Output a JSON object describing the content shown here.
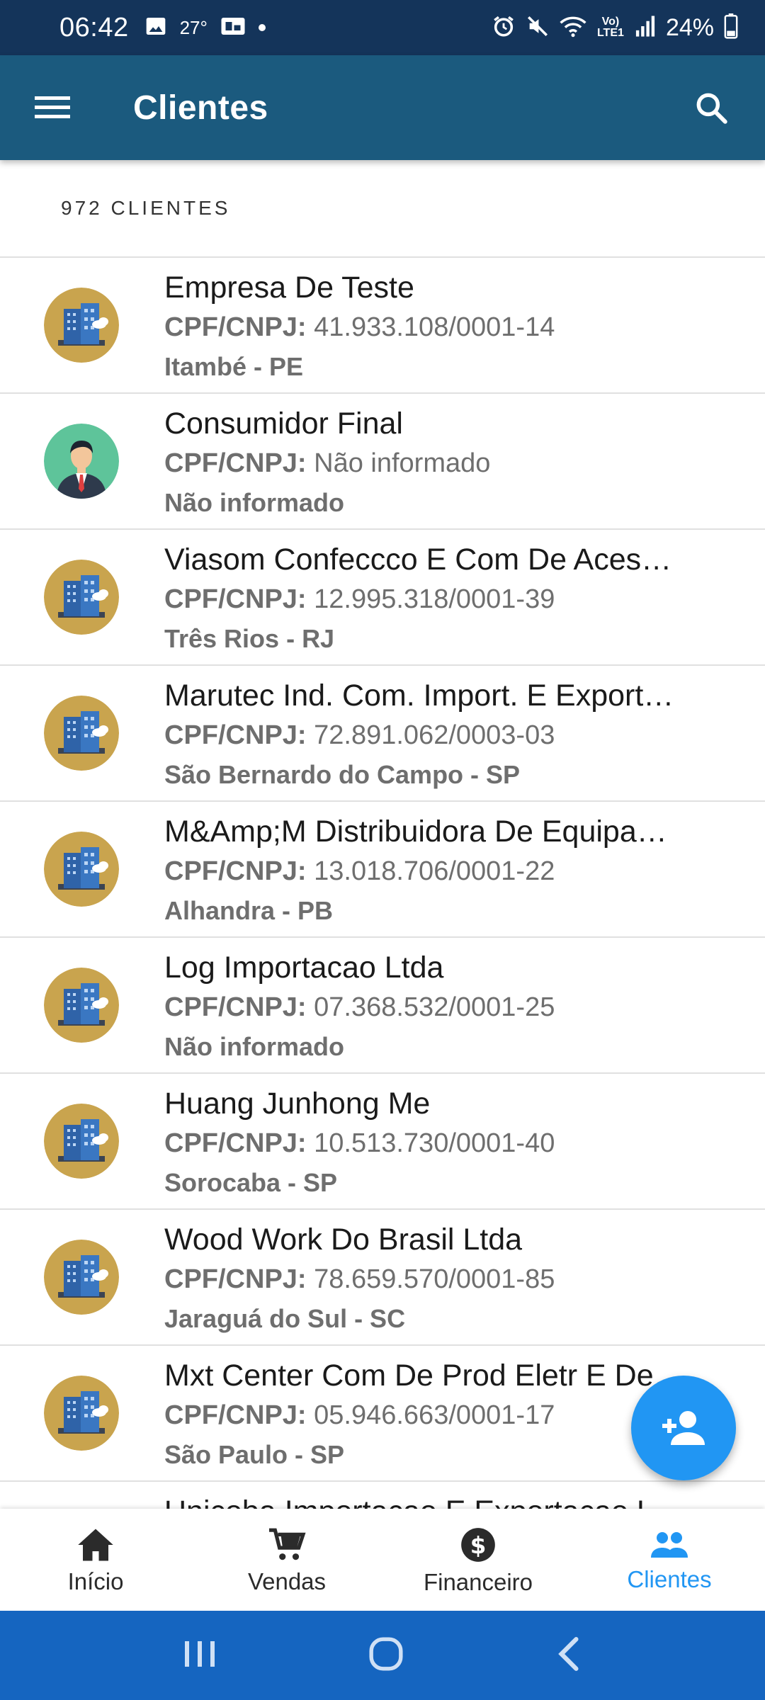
{
  "status_bar": {
    "time": "06:42",
    "temperature": "27°",
    "battery": "24%",
    "network_label": "Vo) LTE1"
  },
  "app_bar": {
    "title": "Clientes"
  },
  "list_header": {
    "count_label": "972 CLIENTES"
  },
  "doc_label": "CPF/CNPJ:",
  "clients": [
    {
      "name": "Empresa De Teste",
      "doc": "41.933.108/0001-14",
      "city": "Itambé - PE",
      "avatar": "building-avatar"
    },
    {
      "name": "Consumidor Final",
      "doc": "Não informado",
      "city": "Não informado",
      "avatar": "person-avatar"
    },
    {
      "name": "Viasom Confeccco E Com De Aces…",
      "doc": "12.995.318/0001-39",
      "city": "Três Rios - RJ",
      "avatar": "building-avatar"
    },
    {
      "name": "Marutec Ind. Com. Import. E Export…",
      "doc": "72.891.062/0003-03",
      "city": "São Bernardo do Campo - SP",
      "avatar": "building-avatar"
    },
    {
      "name": "M&Amp;M Distribuidora De Equipa…",
      "doc": "13.018.706/0001-22",
      "city": "Alhandra - PB",
      "avatar": "building-avatar"
    },
    {
      "name": "Log Importacao Ltda",
      "doc": "07.368.532/0001-25",
      "city": "Não informado",
      "avatar": "building-avatar"
    },
    {
      "name": "Huang Junhong Me",
      "doc": "10.513.730/0001-40",
      "city": "Sorocaba - SP",
      "avatar": "building-avatar"
    },
    {
      "name": "Wood Work Do Brasil Ltda",
      "doc": "78.659.570/0001-85",
      "city": "Jaraguá do Sul - SC",
      "avatar": "building-avatar"
    },
    {
      "name": "Mxt Center Com De Prod Eletr E De…",
      "doc": "05.946.663/0001-17",
      "city": "São Paulo - SP",
      "avatar": "building-avatar"
    },
    {
      "name": "Unicoba Importacao E Exportacao L…",
      "doc": "",
      "city": "",
      "avatar": "building-avatar"
    }
  ],
  "bottom_nav": {
    "items": [
      {
        "label": "Início",
        "icon": "home-icon",
        "active": false
      },
      {
        "label": "Vendas",
        "icon": "cart-icon",
        "active": false
      },
      {
        "label": "Financeiro",
        "icon": "dollar-icon",
        "active": false
      },
      {
        "label": "Clientes",
        "icon": "people-icon",
        "active": true
      }
    ]
  },
  "colors": {
    "status_bar": "#14345a",
    "app_bar": "#1b5a7e",
    "accent": "#2196f3",
    "system_nav": "#1565c0"
  }
}
